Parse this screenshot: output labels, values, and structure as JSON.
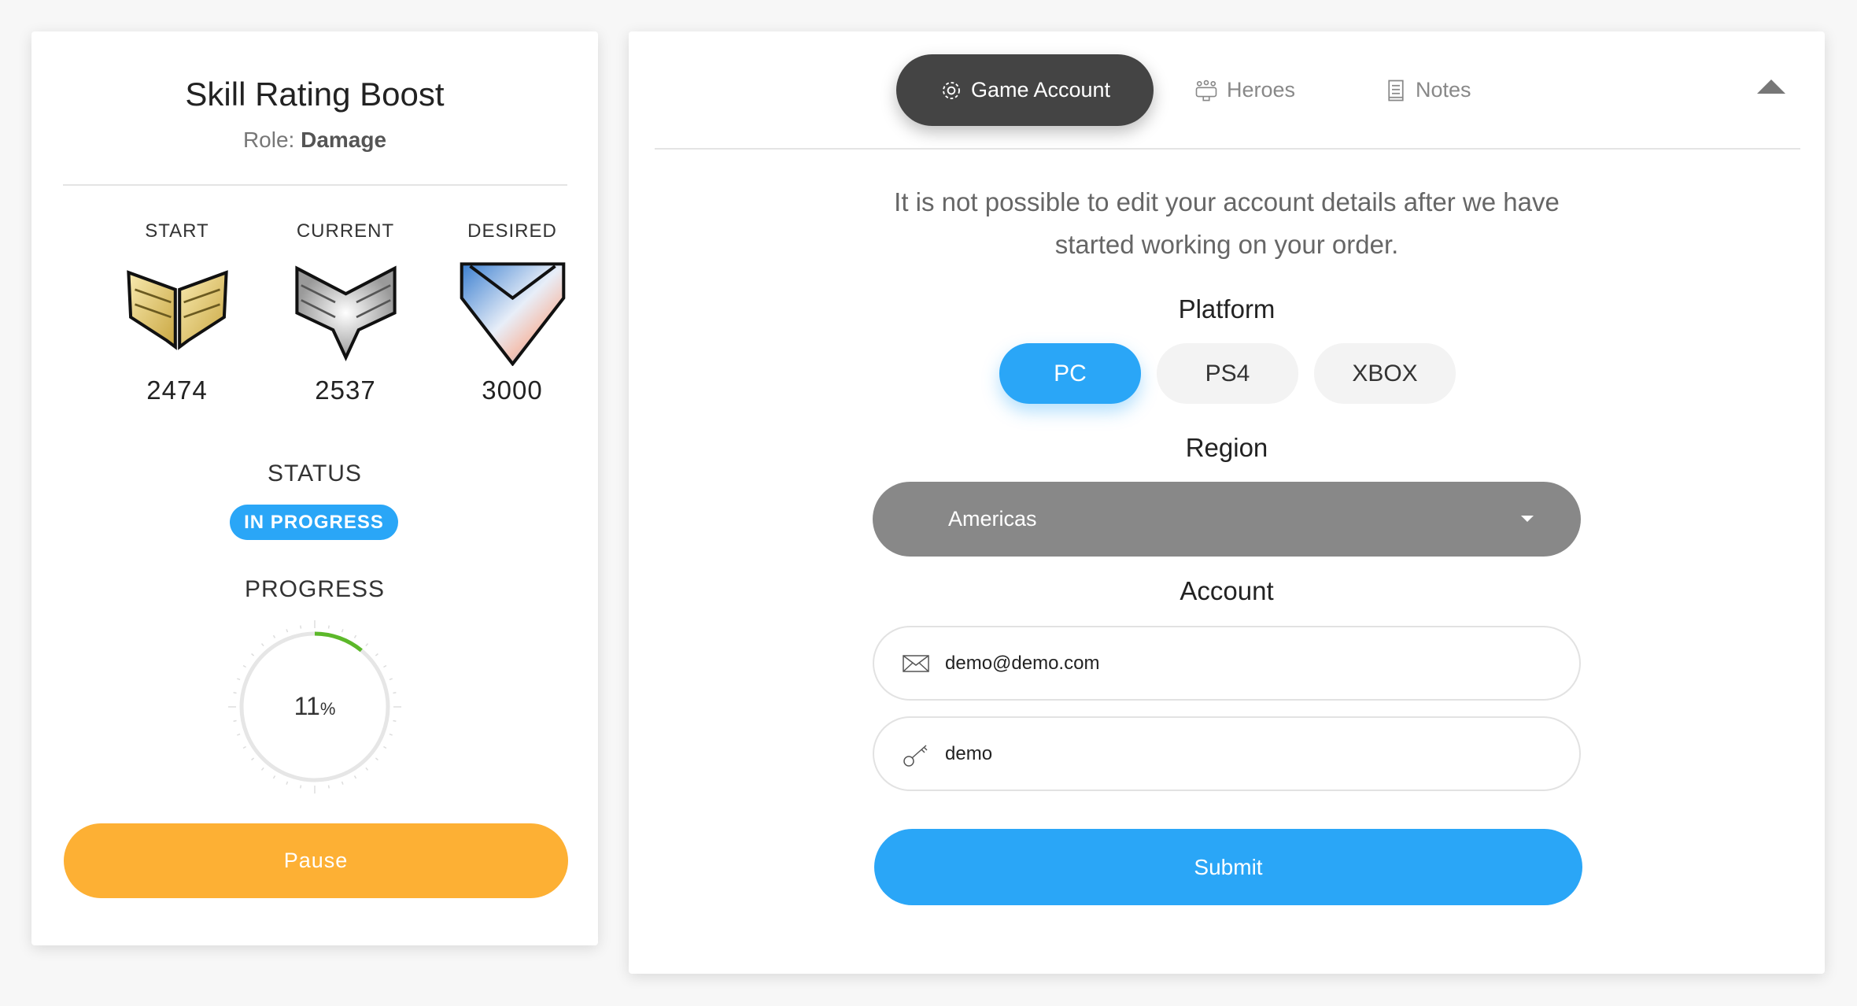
{
  "order": {
    "title": "Skill Rating Boost",
    "role_label": "Role:",
    "role_value": "Damage",
    "ratings": [
      {
        "label": "START",
        "value": "2474",
        "tier": "gold"
      },
      {
        "label": "CURRENT",
        "value": "2537",
        "tier": "platinum"
      },
      {
        "label": "DESIRED",
        "value": "3000",
        "tier": "diamond"
      }
    ],
    "status_label": "STATUS",
    "status_value": "IN PROGRESS",
    "progress_label": "PROGRESS",
    "progress_number": "11",
    "progress_unit": "%",
    "progress_fraction": 0.11,
    "pause_label": "Pause"
  },
  "tabs": [
    {
      "label": "Game Account",
      "icon": "gear-icon",
      "active": true
    },
    {
      "label": "Heroes",
      "icon": "people-icon",
      "active": false
    },
    {
      "label": "Notes",
      "icon": "document-icon",
      "active": false
    }
  ],
  "account_form": {
    "message": "It is not possible to edit your account details after we have started working on your order.",
    "platform_label": "Platform",
    "platforms": [
      "PC",
      "PS4",
      "XBOX"
    ],
    "selected_platform": "PC",
    "region_label": "Region",
    "region_value": "Americas",
    "account_label": "Account",
    "email_value": "demo@demo.com",
    "password_value": "demo",
    "submit_label": "Submit"
  },
  "colors": {
    "accent": "#2aa6f7",
    "pause": "#fdb034",
    "progress": "#5cb82a",
    "active_tab": "#444444"
  }
}
